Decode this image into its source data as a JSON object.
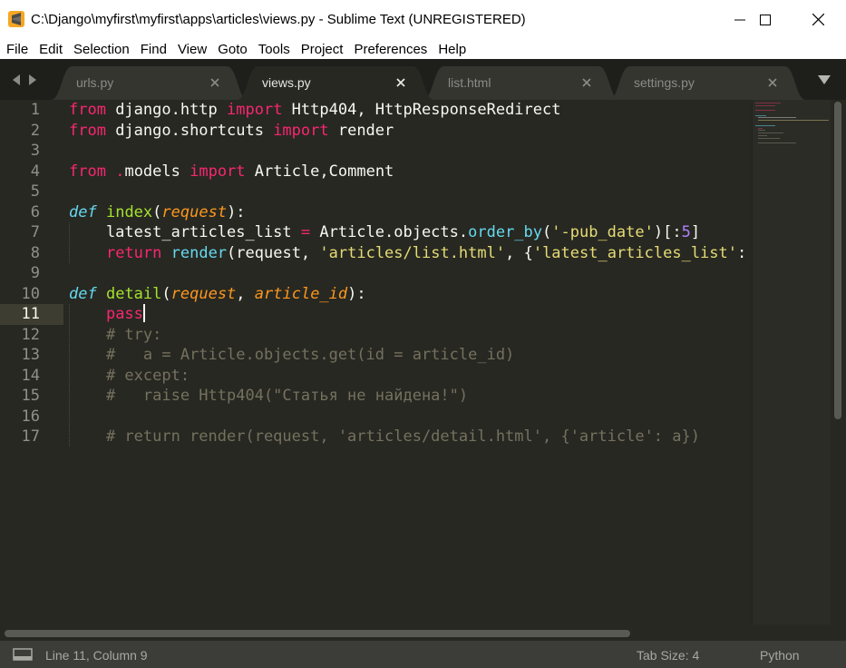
{
  "window": {
    "title": "C:\\Django\\myfirst\\myfirst\\apps\\articles\\views.py - Sublime Text (UNREGISTERED)",
    "icon": "sublime-logo-icon"
  },
  "menu": {
    "items": [
      "File",
      "Edit",
      "Selection",
      "Find",
      "View",
      "Goto",
      "Tools",
      "Project",
      "Preferences",
      "Help"
    ]
  },
  "tabs": [
    {
      "label": "urls.py",
      "active": false
    },
    {
      "label": "views.py",
      "active": true
    },
    {
      "label": "list.html",
      "active": false
    },
    {
      "label": "settings.py",
      "active": false
    }
  ],
  "editor": {
    "current_line": 11,
    "line_numbers": [
      "1",
      "2",
      "3",
      "4",
      "5",
      "6",
      "7",
      "8",
      "9",
      "10",
      "11",
      "12",
      "13",
      "14",
      "15",
      "16",
      "17"
    ],
    "code": [
      "from django.http import Http404, HttpResponseRedirect",
      "from django.shortcuts import render",
      "",
      "from .models import Article,Comment",
      "",
      "def index(request):",
      "    latest_articles_list = Article.objects.order_by('-pub_date')[:5]",
      "    return render(request, 'articles/list.html', {'latest_articles_list':",
      "",
      "def detail(request, article_id):",
      "    pass",
      "    # try:",
      "    #   a = Article.objects.get(id = article_id)",
      "    # except:",
      "    #   raise Http404(\"Статья не найдена!\")",
      "",
      "    # return render(request, 'articles/detail.html', {'article': a})"
    ]
  },
  "status": {
    "position": "Line 11, Column 9",
    "tab_size": "Tab Size: 4",
    "syntax": "Python"
  },
  "colors": {
    "background": "#272822",
    "keyword": "#f92672",
    "function": "#a6e22e",
    "string": "#e6db74",
    "comment": "#75715e",
    "parameter": "#fd971f",
    "storage": "#66d9ef"
  }
}
